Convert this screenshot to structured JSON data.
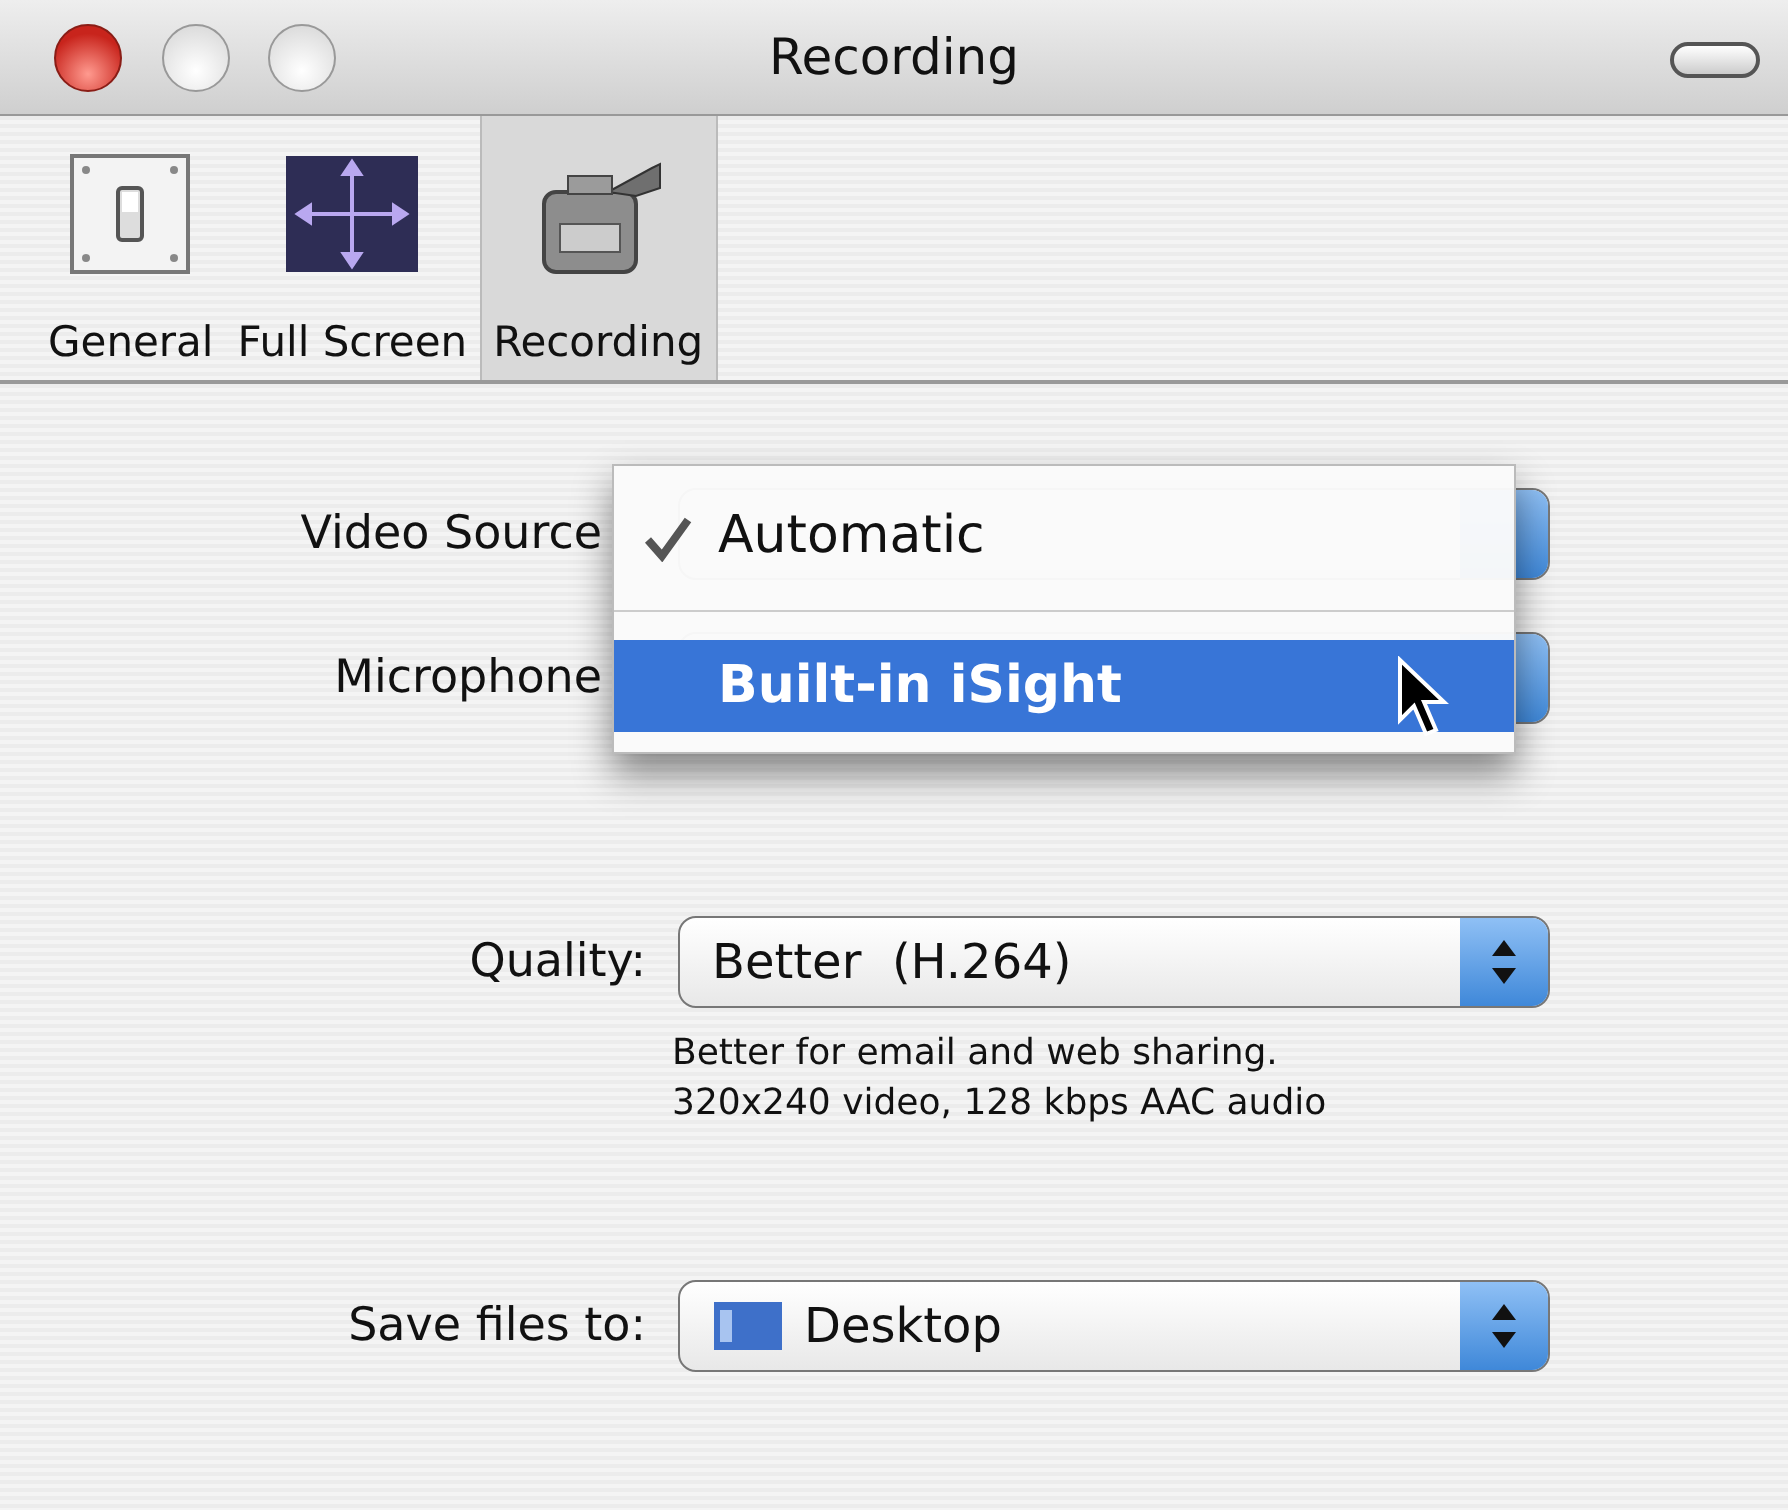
{
  "window": {
    "title": "Recording"
  },
  "toolbar": [
    {
      "label": "General",
      "selected": false
    },
    {
      "label": "Full Screen",
      "selected": false
    },
    {
      "label": "Recording",
      "selected": true
    }
  ],
  "rows": [
    {
      "kind": "popup",
      "label": "Video Source"
    },
    {
      "kind": "popup",
      "label": "Microphone"
    },
    {
      "kind": "popup",
      "label": "Quality:",
      "value": "Better  (H.264)",
      "note": [
        "Better for email and web sharing.",
        "320x240 video, 128 kbps AAC audio"
      ]
    },
    {
      "kind": "folder",
      "label": "Save files to:",
      "value": "Desktop"
    }
  ],
  "menu": {
    "items": [
      {
        "label": "Automatic",
        "checked": true,
        "selected": false
      },
      {
        "label": "Built-in iSight",
        "checked": false,
        "selected": true
      }
    ]
  }
}
